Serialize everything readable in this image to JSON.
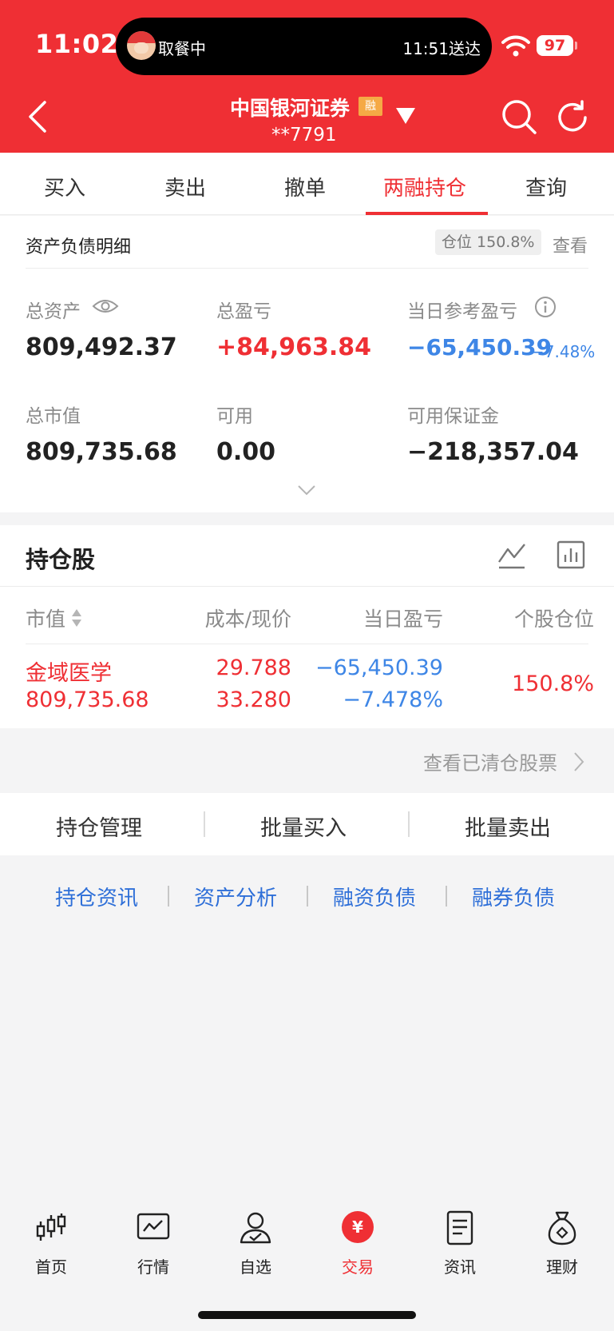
{
  "status_bar": {
    "time": "11:02",
    "island_left": "取餐中",
    "island_right": "11:51送达",
    "battery": "97"
  },
  "header": {
    "account_name": "中国银河证券",
    "badge": "融",
    "account_no": "**7791"
  },
  "tabs": [
    "买入",
    "卖出",
    "撤单",
    "两融持仓",
    "查询"
  ],
  "assets": {
    "section_title": "资产负债明细",
    "position_ratio": "仓位 150.8%",
    "view_label": "查看",
    "total_assets_label": "总资产",
    "total_assets": "809,492.37",
    "total_pnl_label": "总盈亏",
    "total_pnl": "+84,963.84",
    "daily_pnl_label": "当日参考盈亏",
    "daily_pnl": "−65,450.39",
    "daily_pnl_pct": "−7.48%",
    "market_value_label": "总市值",
    "market_value": "809,735.68",
    "available_label": "可用",
    "available": "0.00",
    "margin_label": "可用保证金",
    "margin": "−218,357.04"
  },
  "holdings": {
    "title": "持仓股",
    "headers": {
      "market_value": "市值",
      "cost_price": "成本/现价",
      "daily_pnl": "当日盈亏",
      "position": "个股仓位"
    },
    "rows": [
      {
        "name": "金域医学",
        "market_value": "809,735.68",
        "cost": "29.788",
        "price": "33.280",
        "daily_pnl": "−65,450.39",
        "daily_pnl_pct": "−7.478%",
        "position": "150.8%"
      }
    ],
    "cleared_link": "查看已清仓股票"
  },
  "management": [
    "持仓管理",
    "批量买入",
    "批量卖出"
  ],
  "quick_links": [
    "持仓资讯",
    "资产分析",
    "融资负债",
    "融券负债"
  ],
  "nav": [
    "首页",
    "行情",
    "自选",
    "交易",
    "资讯",
    "理财"
  ],
  "colors": {
    "brand_red": "#ef2f34",
    "loss_blue": "#3e86e6",
    "link_blue": "#2e6fd8",
    "badge_orange": "#f5a945"
  }
}
